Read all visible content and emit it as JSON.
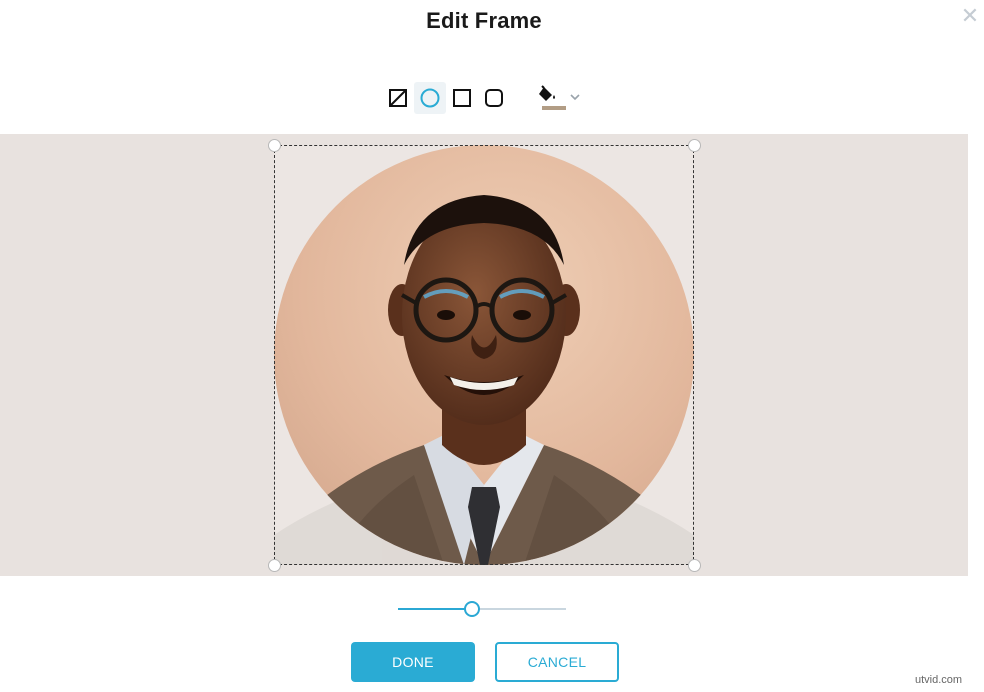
{
  "dialog": {
    "title": "Edit Frame",
    "close_icon": "close-icon"
  },
  "toolbar": {
    "shapes": [
      {
        "name": "no-frame",
        "icon": "slash-square-icon",
        "selected": false
      },
      {
        "name": "circle",
        "icon": "circle-icon",
        "selected": true
      },
      {
        "name": "square",
        "icon": "square-icon",
        "selected": false
      },
      {
        "name": "rounded-square",
        "icon": "rounded-square-icon",
        "selected": false
      }
    ],
    "fill": {
      "icon": "paint-bucket-icon",
      "color": "#b29d85",
      "dropdown_icon": "chevron-down-icon"
    }
  },
  "canvas": {
    "background_color": "#e8e2df",
    "image": {
      "subject": "smiling man with glasses in tweed jacket",
      "frame_shape": "circle"
    }
  },
  "zoom_slider": {
    "value": 0.44
  },
  "buttons": {
    "done_label": "DONE",
    "cancel_label": "CANCEL"
  },
  "colors": {
    "accent": "#2aabd4"
  },
  "watermark": "utvid.com"
}
